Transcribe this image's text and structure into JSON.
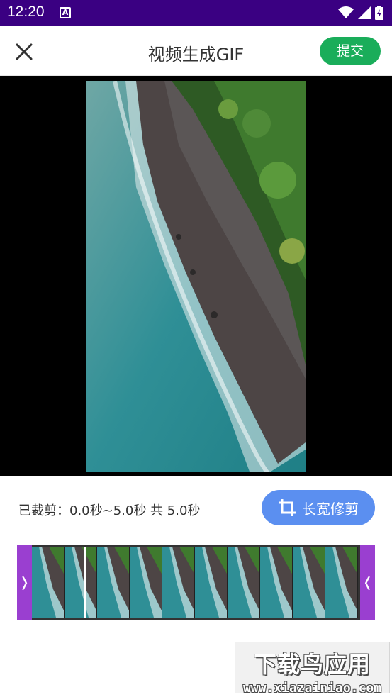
{
  "status_bar": {
    "time": "12:20",
    "notification_icon": "A"
  },
  "header": {
    "title": "视频生成GIF",
    "submit_label": "提交"
  },
  "trim": {
    "info": "已裁剪：0.0秒~5.0秒  共 5.0秒",
    "aspect_button_label": "长宽修剪"
  },
  "timeline": {
    "frame_count": 10
  },
  "watermark": {
    "main": "下载鸟应用",
    "url": "www.xiazainiao.com"
  },
  "colors": {
    "status_bar": "#3a0082",
    "submit": "#1aad5a",
    "aspect_button": "#5b8ff0",
    "trim_handle": "#9a3fd0"
  }
}
